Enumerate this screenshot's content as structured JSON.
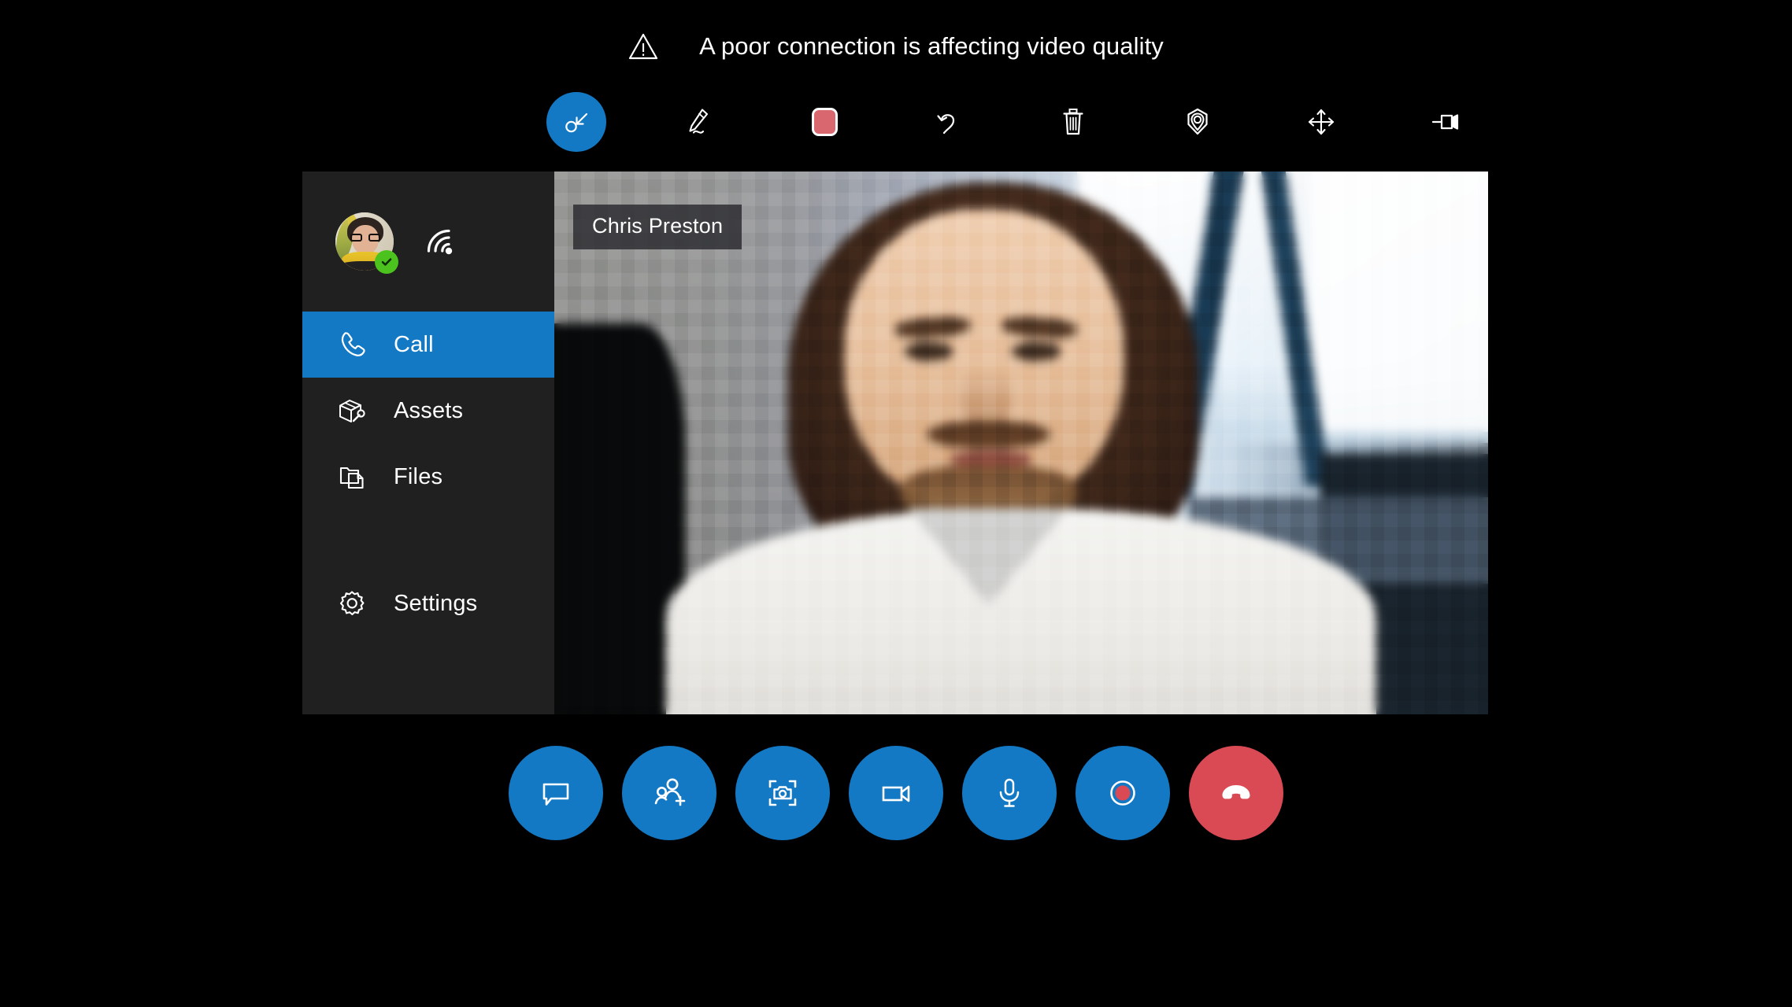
{
  "app": {
    "title": "Remote Assist Call",
    "accent_color": "#1379c4",
    "danger_color": "#da4a55",
    "sidebar_bg": "#202020",
    "background": "#000000"
  },
  "warning": {
    "icon": "warning-triangle-icon",
    "message": "A poor connection is affecting video quality"
  },
  "toolbar": {
    "items": [
      {
        "name": "cursor-select-tool",
        "icon": "cursor-arrow-circle-icon",
        "label": "Select",
        "active": true
      },
      {
        "name": "ink-pen-tool",
        "icon": "pen-ink-icon",
        "label": "Ink",
        "active": false
      },
      {
        "name": "ink-color-swatch",
        "icon": "color-swatch-icon",
        "label": "Color",
        "active": false,
        "color": "#d9676f"
      },
      {
        "name": "undo-button",
        "icon": "undo-arrow-icon",
        "label": "Undo",
        "active": false
      },
      {
        "name": "delete-button",
        "icon": "trash-can-icon",
        "label": "Delete all",
        "active": false
      },
      {
        "name": "place-marker-tool",
        "icon": "location-marker-icon",
        "label": "Place marker",
        "active": false
      },
      {
        "name": "move-tool",
        "icon": "move-arrows-icon",
        "label": "Move",
        "active": false
      },
      {
        "name": "pin-toolbar-button",
        "icon": "pushpin-icon",
        "label": "Pin",
        "active": false
      }
    ]
  },
  "sidebar": {
    "profile": {
      "avatar_alt": "User avatar",
      "presence": "available",
      "presence_color": "#4cc21f",
      "signal_icon": "wifi-signal-icon"
    },
    "items": [
      {
        "label": "Call",
        "icon": "phone-handset-icon",
        "active": true
      },
      {
        "label": "Assets",
        "icon": "box-wrench-icon",
        "active": false
      },
      {
        "label": "Files",
        "icon": "folder-document-icon",
        "active": false
      },
      {
        "label": "Settings",
        "icon": "gear-icon",
        "active": false
      }
    ]
  },
  "video": {
    "participant_name": "Chris Preston"
  },
  "call_controls": [
    {
      "name": "chat-button",
      "icon": "chat-bubble-icon",
      "label": "Chat",
      "style": "primary"
    },
    {
      "name": "add-participant-button",
      "icon": "add-person-icon",
      "label": "Add people",
      "style": "primary"
    },
    {
      "name": "snapshot-button",
      "icon": "camera-capture-icon",
      "label": "Take snapshot",
      "style": "primary"
    },
    {
      "name": "video-toggle-button",
      "icon": "video-camera-icon",
      "label": "Video",
      "style": "primary"
    },
    {
      "name": "mic-toggle-button",
      "icon": "microphone-icon",
      "label": "Mute",
      "style": "primary"
    },
    {
      "name": "record-button",
      "icon": "record-circle-icon",
      "label": "Record",
      "style": "primary"
    },
    {
      "name": "hang-up-button",
      "icon": "hang-up-handset-icon",
      "label": "End call",
      "style": "danger"
    }
  ]
}
